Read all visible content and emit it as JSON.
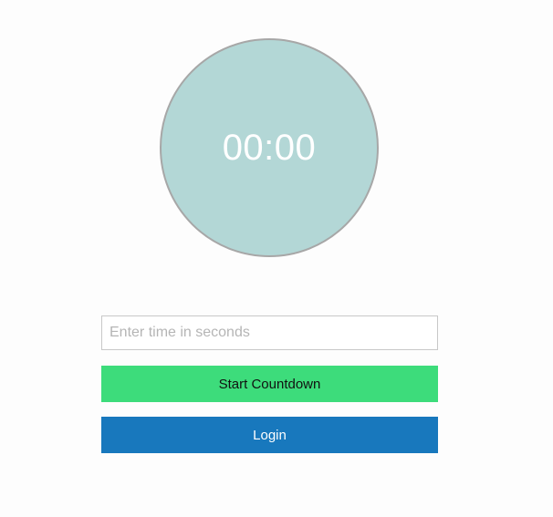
{
  "timer": {
    "display": "00:00",
    "circle_color": "#b3d7d6"
  },
  "form": {
    "time_input": {
      "value": "",
      "placeholder": "Enter time in seconds"
    },
    "start_button": {
      "label": "Start Countdown",
      "color": "#3ddc7b"
    },
    "login_button": {
      "label": "Login",
      "color": "#1878bd"
    }
  }
}
